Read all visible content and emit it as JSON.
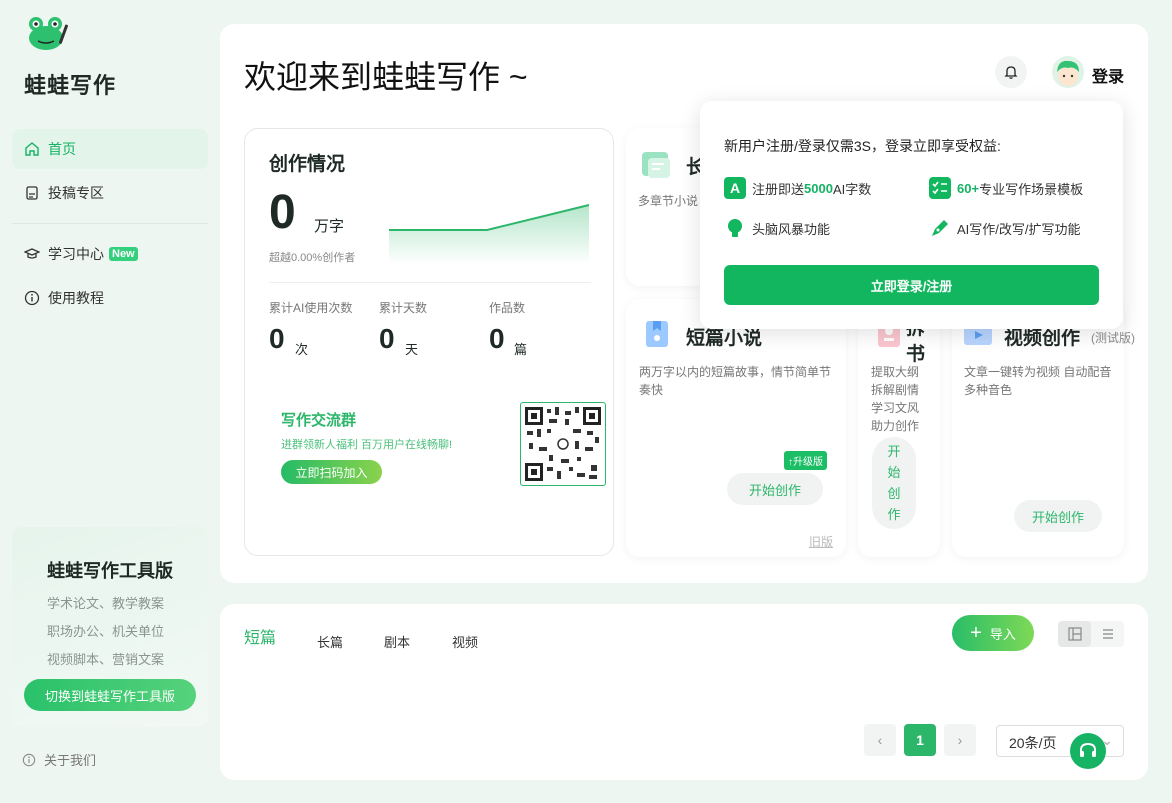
{
  "sidebar": {
    "brand": "蛙蛙写作",
    "items": [
      {
        "label": "首页",
        "icon": "home-icon"
      },
      {
        "label": "投稿专区",
        "icon": "submit-icon"
      },
      {
        "label": "学习中心",
        "icon": "graduation-cap-icon",
        "badge": "New"
      },
      {
        "label": "使用教程",
        "icon": "info-icon"
      }
    ],
    "promo": {
      "title": "蛙蛙写作工具版",
      "lines": [
        "学术论文、教学教案",
        "职场办公、机关单位",
        "视频脚本、营销文案"
      ],
      "button": "切换到蛙蛙写作工具版"
    },
    "about": "关于我们"
  },
  "header": {
    "title": "欢迎来到蛙蛙写作 ~",
    "login": "登录"
  },
  "stats": {
    "title": "创作情况",
    "word_count": "0",
    "word_unit": "万字",
    "surpass": "超越0.00%创作者",
    "items": [
      {
        "label": "累计AI使用次数",
        "value": "0",
        "unit": "次"
      },
      {
        "label": "累计天数",
        "value": "0",
        "unit": "天"
      },
      {
        "label": "作品数",
        "value": "0",
        "unit": "篇"
      }
    ],
    "community": {
      "title": "写作交流群",
      "desc": "进群领新人福利 百万用户在线畅聊!",
      "button": "立即扫码加入"
    }
  },
  "cards": {
    "long": {
      "title_visible": "长",
      "desc_visible": "多章节小说"
    },
    "short": {
      "title": "短篇小说",
      "desc": "两万字以内的短篇故事，情节简单节奏快",
      "badge": "升级版",
      "button": "开始创作",
      "old": "旧版"
    },
    "split": {
      "title_chars": [
        "拆",
        "书"
      ],
      "desc": "提取大纲 拆解剧情 学习文风 助力创作",
      "button_chars": [
        "开",
        "始",
        "创",
        "作"
      ]
    },
    "video": {
      "title": "视频创作",
      "tag": "(测试版)",
      "desc": "文章一键转为视频 自动配音 多种音色",
      "button": "开始创作"
    }
  },
  "popup": {
    "headline": "新用户注册/登录仅需3S，登录立即享受权益:",
    "f1_pre": "注册即送",
    "f1_em": "5000",
    "f1_post": "AI字数",
    "f2_em": "60+",
    "f2_post": "专业写作场景模板",
    "f3": "头脑风暴功能",
    "f4": "AI写作/改写/扩写功能",
    "button": "立即登录/注册"
  },
  "works": {
    "tabs": [
      "短篇",
      "长篇",
      "剧本",
      "视频"
    ],
    "active_tab": "短篇",
    "import": "导入",
    "pagination": {
      "current": "1",
      "page_size": "20条/页"
    }
  },
  "colors": {
    "accent": "#16b364",
    "background": "#eef6f1"
  }
}
